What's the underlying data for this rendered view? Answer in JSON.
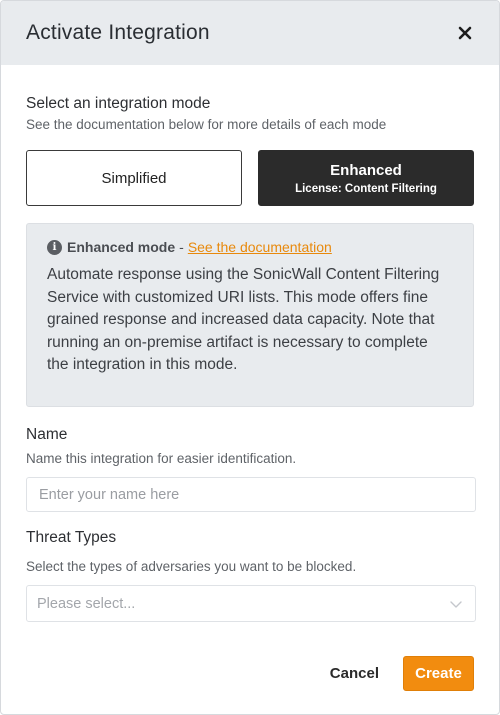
{
  "dialog": {
    "title": "Activate Integration",
    "close_icon": "close-icon"
  },
  "mode_section": {
    "label": "Select an integration mode",
    "sublabel": "See the documentation below for more details of each mode",
    "options": [
      {
        "title": "Simplified",
        "subtitle": "",
        "selected": false
      },
      {
        "title": "Enhanced",
        "subtitle": "License: Content Filtering",
        "selected": true
      }
    ]
  },
  "info": {
    "icon": "info-icon",
    "title": "Enhanced mode",
    "separator": "-",
    "link_text": "See the documentation",
    "text": "Automate response using the SonicWall Content Filtering Service with customized URI lists. This mode offers fine grained response and increased data capacity. Note that running an on-premise artifact is necessary to complete the integration in this mode."
  },
  "name_field": {
    "label": "Name",
    "sublabel": "Name this integration for easier identification.",
    "value": "",
    "placeholder": "Enter your name here"
  },
  "threat_field": {
    "label": "Threat Types",
    "sublabel": "Select the types of adversaries you want to be blocked.",
    "placeholder": "Please select...",
    "icon": "chevron-down-icon"
  },
  "footer": {
    "cancel_label": "Cancel",
    "create_label": "Create"
  },
  "colors": {
    "accent": "#f28c0f",
    "link": "#e8890c",
    "header_bg": "#e8ebee",
    "selected_mode_bg": "#2b2b2b"
  }
}
